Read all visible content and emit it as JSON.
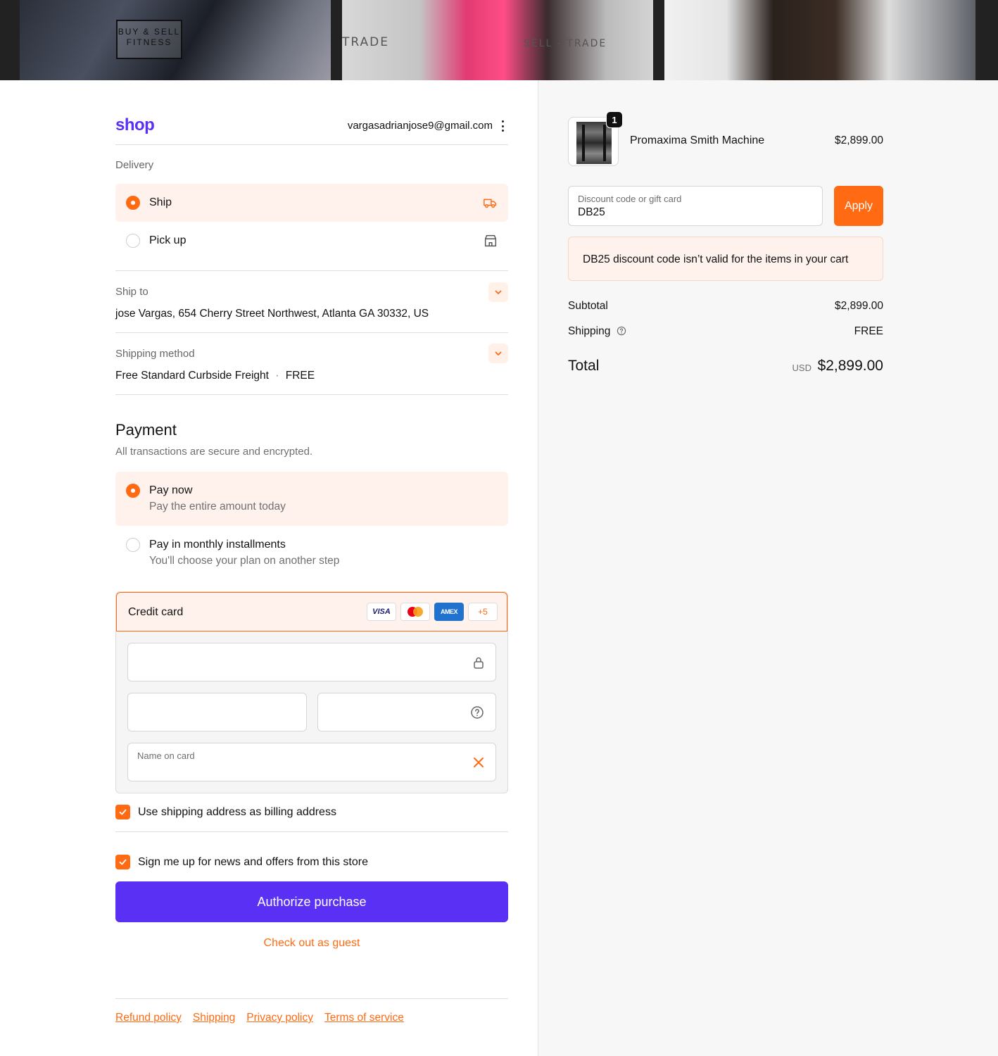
{
  "banner": {
    "logo_line1": "BUY & SELL",
    "logo_line2": "FITNESS",
    "word_center": "TRADE",
    "word_right": "SELL - TRADE"
  },
  "header": {
    "shop_logo": "shop",
    "account_email": "vargasadrianjose9@gmail.com"
  },
  "delivery": {
    "section_label": "Delivery",
    "options": [
      {
        "label": "Ship",
        "selected": true,
        "icon": "truck-icon"
      },
      {
        "label": "Pick up",
        "selected": false,
        "icon": "store-icon"
      }
    ]
  },
  "ship_to": {
    "title": "Ship to",
    "value": "jose Vargas, 654 Cherry Street Northwest, Atlanta GA 30332, US"
  },
  "shipping_method": {
    "title": "Shipping method",
    "value": "Free Standard Curbside Freight",
    "separator": "·",
    "price": "FREE"
  },
  "payment": {
    "title": "Payment",
    "subtitle": "All transactions are secure and encrypted.",
    "options": [
      {
        "title": "Pay now",
        "subtitle": "Pay the entire amount today",
        "selected": true
      },
      {
        "title": "Pay in monthly installments",
        "subtitle": "You'll choose your plan on another step",
        "selected": false
      }
    ],
    "credit_card": {
      "label": "Credit card",
      "brands": [
        "VISA",
        "mastercard",
        "AMEX",
        "+5"
      ],
      "name_placeholder": "Name on card"
    }
  },
  "checkboxes": {
    "billing": "Use shipping address as billing address",
    "newsletter": "Sign me up for news and offers from this store"
  },
  "actions": {
    "authorize": "Authorize purchase",
    "guest": "Check out as guest"
  },
  "footer": {
    "links": [
      "Refund policy",
      "Shipping",
      "Privacy policy",
      "Terms of service"
    ]
  },
  "order": {
    "product_name": "Promaxima Smith Machine",
    "product_price": "$2,899.00",
    "quantity": "1",
    "discount_placeholder": "Discount code or gift card",
    "discount_value": "DB25",
    "apply_label": "Apply",
    "discount_error": "DB25 discount code isn’t valid for the items in your cart",
    "subtotal_label": "Subtotal",
    "subtotal_value": "$2,899.00",
    "shipping_label": "Shipping",
    "shipping_value": "FREE",
    "total_label": "Total",
    "total_currency": "USD",
    "total_value": "$2,899.00"
  },
  "colors": {
    "accent": "#ff6a13",
    "shop_purple": "#5a31f4",
    "selected_bg": "#fff2ec"
  }
}
